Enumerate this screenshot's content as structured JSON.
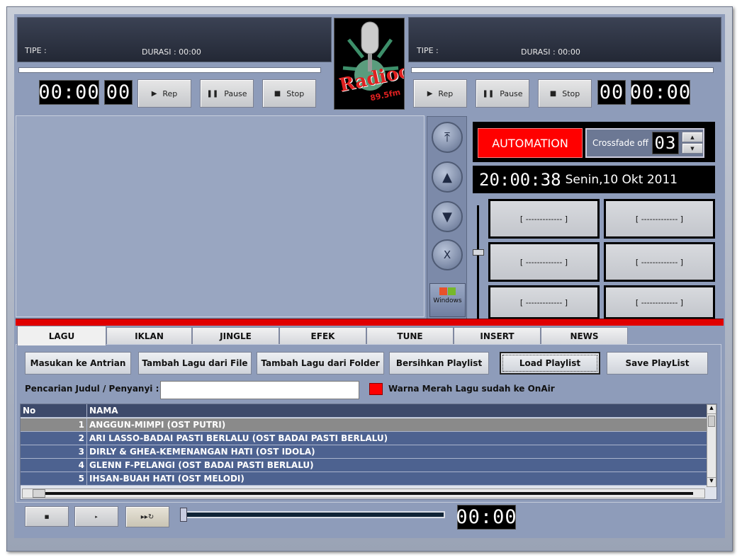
{
  "left_deck": {
    "tipe_label": "TIPE :",
    "durasi_label": "DURASI : 00:00",
    "time": "00:00",
    "sub": "00",
    "rep": "Rep",
    "pause": "Pause",
    "stop": "Stop"
  },
  "right_deck": {
    "tipe_label": "TIPE :",
    "durasi_label": "DURASI : 00:00",
    "time": "00:00",
    "sub": "00",
    "rep": "Rep",
    "pause": "Pause",
    "stop": "Stop"
  },
  "logo": {
    "text": "Radioc",
    "sub": "89.5 fm"
  },
  "nav": {
    "windows_label": "Windows",
    "delete_label": "X"
  },
  "automation": {
    "label": "AUTOMATION",
    "crossfade_label": "Crossfade off",
    "crossfade_value": "03"
  },
  "clock": {
    "time": "20:00:38",
    "date": "Senin,10 Okt 2011"
  },
  "carts": [
    "[ ------------- ]",
    "[ ------------- ]",
    "[ ------------- ]",
    "[ ------------- ]",
    "[ ------------- ]",
    "[ ------------- ]"
  ],
  "tabs": [
    "LAGU",
    "IKLAN",
    "JINGLE",
    "EFEK",
    "TUNE",
    "INSERT",
    "NEWS"
  ],
  "active_tab": "LAGU",
  "toolbar": [
    "Masukan ke Antrian",
    "Tambah Lagu dari File",
    "Tambah Lagu dari Folder",
    "Bersihkan Playlist",
    "Load Playlist",
    "Save PlayList"
  ],
  "search": {
    "label": "Pencarian Judul / Penyanyi :",
    "value": "",
    "legend": "Warna Merah Lagu sudah ke OnAir",
    "legend_color": "#ff0000"
  },
  "table": {
    "headers": [
      "No",
      "NAMA"
    ],
    "rows": [
      {
        "no": "1",
        "nama": "ANGGUN-MIMPI (OST PUTRI)"
      },
      {
        "no": "2",
        "nama": "ARI LASSO-BADAI PASTI BERLALU (OST BADAI PASTI BERLALU)"
      },
      {
        "no": "3",
        "nama": "DIRLY & GHEA-KEMENANGAN HATI (OST IDOLA)"
      },
      {
        "no": "4",
        "nama": "GLENN F-PELANGI (OST BADAI PASTI BERLALU)"
      },
      {
        "no": "5",
        "nama": "IHSAN-BUAH HATI (OST MELODI)"
      }
    ]
  },
  "preview": {
    "time": "00:00"
  },
  "colors": {
    "automation": "#ff0000",
    "selected_row": "#8a8a8a",
    "row": "#4d6290",
    "header": "#3d4a6b",
    "accent_bar": "#e00000"
  }
}
